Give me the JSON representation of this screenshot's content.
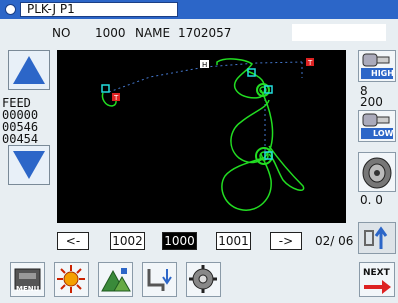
{
  "title": {
    "text": "PLK-J P1"
  },
  "info": {
    "no_label": "NO",
    "no_value": "1000",
    "name_label": "NAME",
    "name_value": "1702057"
  },
  "feed": {
    "label": "FEED",
    "values": [
      "00000",
      "00546",
      "00454"
    ]
  },
  "side": {
    "value_top": "8",
    "value_mid": "200",
    "value_bottom": "0. 0",
    "high_label": "HIGH",
    "low_label": "LOW"
  },
  "nav": {
    "prev": "<-",
    "items": [
      "1002",
      "1000",
      "1001"
    ],
    "next": "->",
    "page": "02/ 06",
    "selected": "1000"
  },
  "buttons": {
    "menu": "MENU",
    "next": "NEXT"
  },
  "canvas_labels": {
    "h": "H",
    "t": "T"
  },
  "colors": {
    "accent": "#2c66c8",
    "path": "#22dd22",
    "marker_t": "#dd2222",
    "marker_o": "#22dddd"
  }
}
